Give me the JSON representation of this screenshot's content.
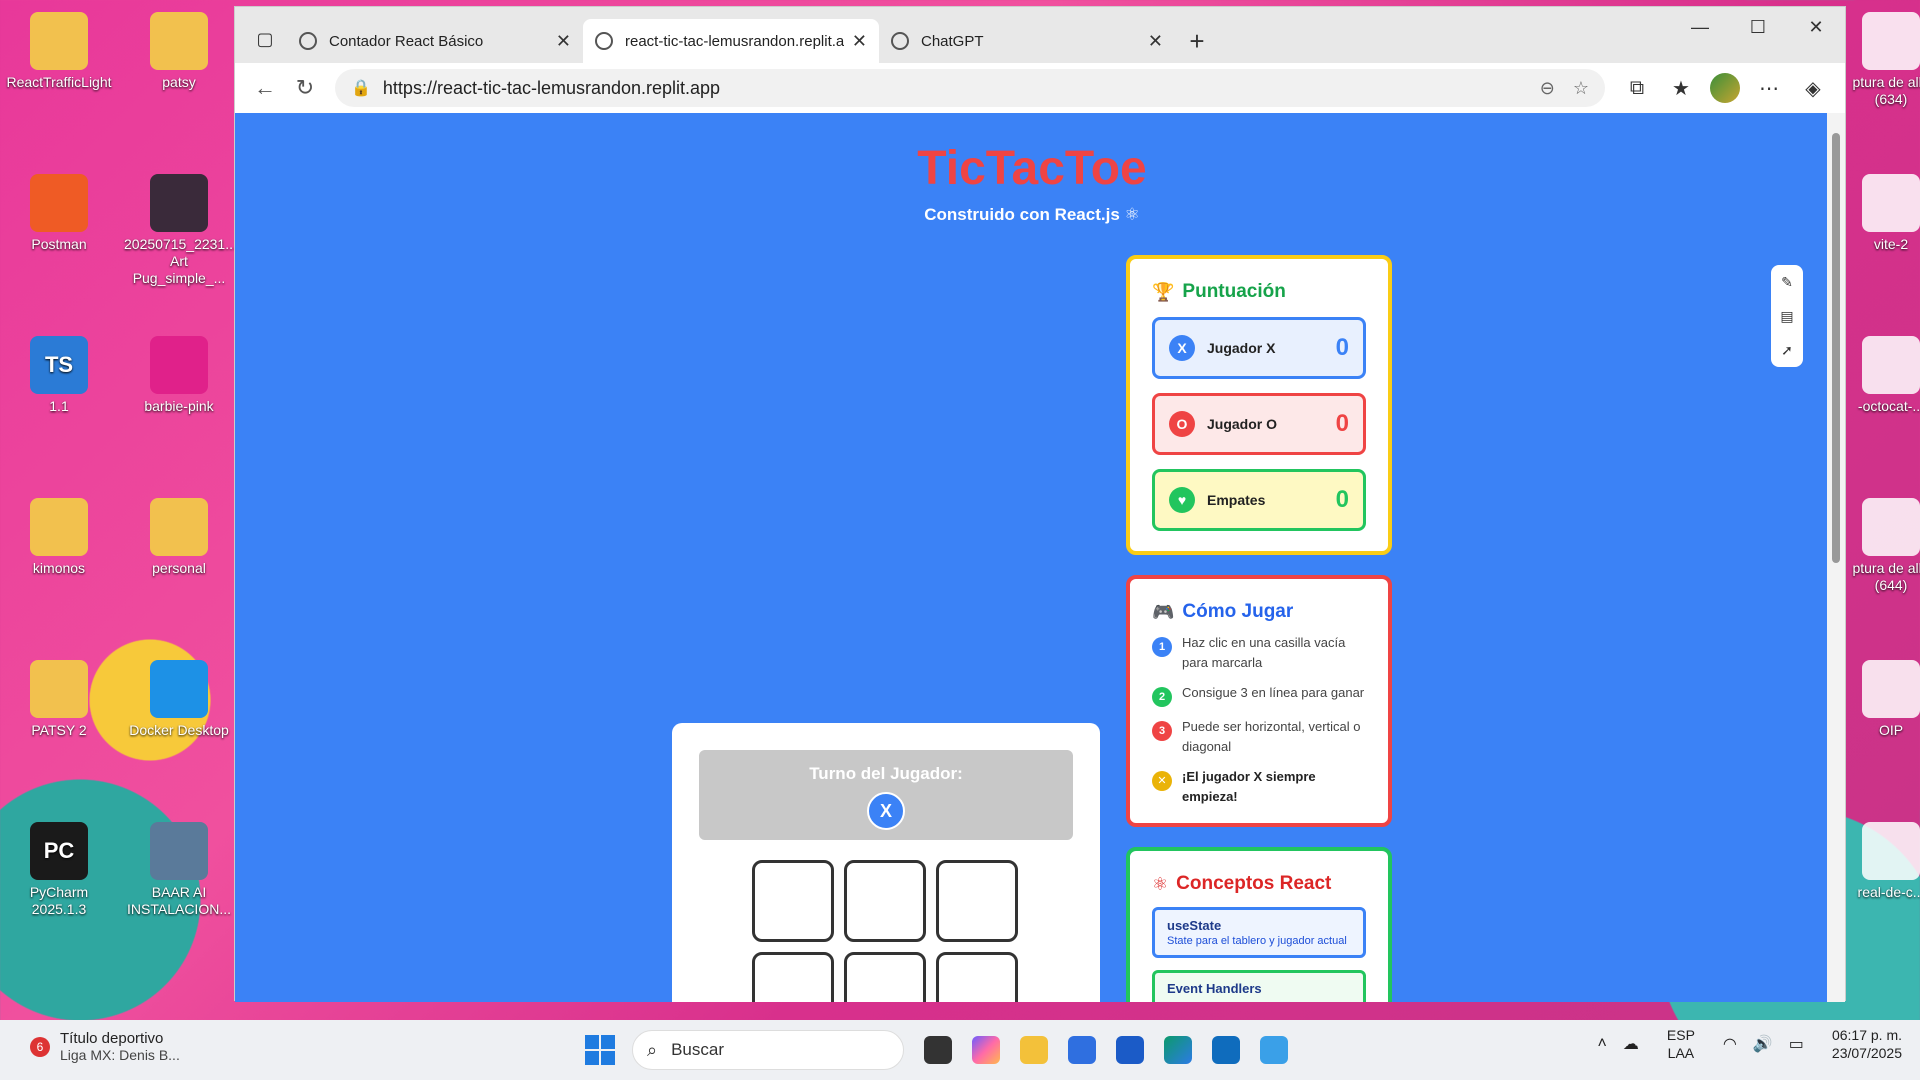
{
  "desktop": {
    "icons_left": [
      {
        "label": "ReactTrafficLight",
        "color": "#f2c14e"
      },
      {
        "label": "Postman",
        "color": "#ef5b25"
      },
      {
        "label": "1.1",
        "color": "#2b7bd6",
        "glyph": "TS"
      },
      {
        "label": "kimonos",
        "color": "#f2c14e"
      },
      {
        "label": "PATSY 2",
        "color": "#f2c14e"
      },
      {
        "label": "PyCharm 2025.1.3",
        "color": "#1a1a1a",
        "glyph": "PC"
      }
    ],
    "icons_col2": [
      {
        "label": "patsy",
        "color": "#f2c14e"
      },
      {
        "label": "20250715_2231... Art Pug_simple_...",
        "color": "#3a2a3a"
      },
      {
        "label": "barbie-pink",
        "color": "#e0218a"
      },
      {
        "label": "personal",
        "color": "#f2c14e"
      },
      {
        "label": "Docker Desktop",
        "color": "#1d91e6"
      },
      {
        "label": "BAAR AI INSTALACION...",
        "color": "#5a7a9a"
      }
    ],
    "icons_right": [
      {
        "label": "ptura de alla (634)"
      },
      {
        "label": "vite-2"
      },
      {
        "label": "-octocat-..."
      },
      {
        "label": "ptura de alla (644)"
      },
      {
        "label": "OIP"
      },
      {
        "label": "real-de-c..."
      }
    ]
  },
  "browser": {
    "tabs": [
      {
        "label": "Contador React Básico",
        "active": false
      },
      {
        "label": "react-tic-tac-lemusrandon.replit.a",
        "active": true
      },
      {
        "label": "ChatGPT",
        "active": false
      }
    ],
    "url": "https://react-tic-tac-lemusrandon.replit.app",
    "icons": {
      "back": "arrow-left-icon",
      "reload": "reload-icon",
      "zoom": "zoom-out-icon",
      "favorite": "star-icon"
    }
  },
  "app": {
    "title": "TicTacToe",
    "subtitle": "Construido con React.js ⚛",
    "turn_label": "Turno del Jugador:",
    "current_player": "X",
    "board": [
      "",
      "",
      "",
      "",
      "",
      ""
    ],
    "score": {
      "heading": "Puntuación",
      "rows": [
        {
          "name": "Jugador X",
          "value": "0",
          "icon": "X",
          "color": "#3b82f6",
          "bg": "#e8f0fe"
        },
        {
          "name": "Jugador O",
          "value": "0",
          "icon": "O",
          "color": "#ef4444",
          "bg": "#fde8e8"
        },
        {
          "name": "Empates",
          "value": "0",
          "icon": "♥",
          "color": "#22c55e",
          "bg": "#fef9c3"
        }
      ]
    },
    "how": {
      "heading": "Cómo Jugar",
      "items": [
        {
          "num": "1",
          "text": "Haz clic en una casilla vacía para marcarla",
          "color": "#3b82f6"
        },
        {
          "num": "2",
          "text": "Consigue 3 en línea para ganar",
          "color": "#22c55e"
        },
        {
          "num": "3",
          "text": "Puede ser horizontal, vertical o diagonal",
          "color": "#ef4444"
        },
        {
          "num": "✕",
          "text": "¡El jugador X siempre empieza!",
          "color": "#eab308"
        }
      ]
    },
    "concepts": {
      "heading": "Conceptos React",
      "items": [
        {
          "name": "useState",
          "desc": "State para el tablero y jugador actual"
        },
        {
          "name": "Event Handlers",
          "desc": ""
        }
      ]
    }
  },
  "taskbar": {
    "news_badge": "6",
    "news_title": "Título deportivo",
    "news_sub": "Liga MX: Denis B...",
    "search_placeholder": "Buscar",
    "lang_top": "ESP",
    "lang_bottom": "LAA",
    "time": "06:17 p. m.",
    "date": "23/07/2025"
  }
}
